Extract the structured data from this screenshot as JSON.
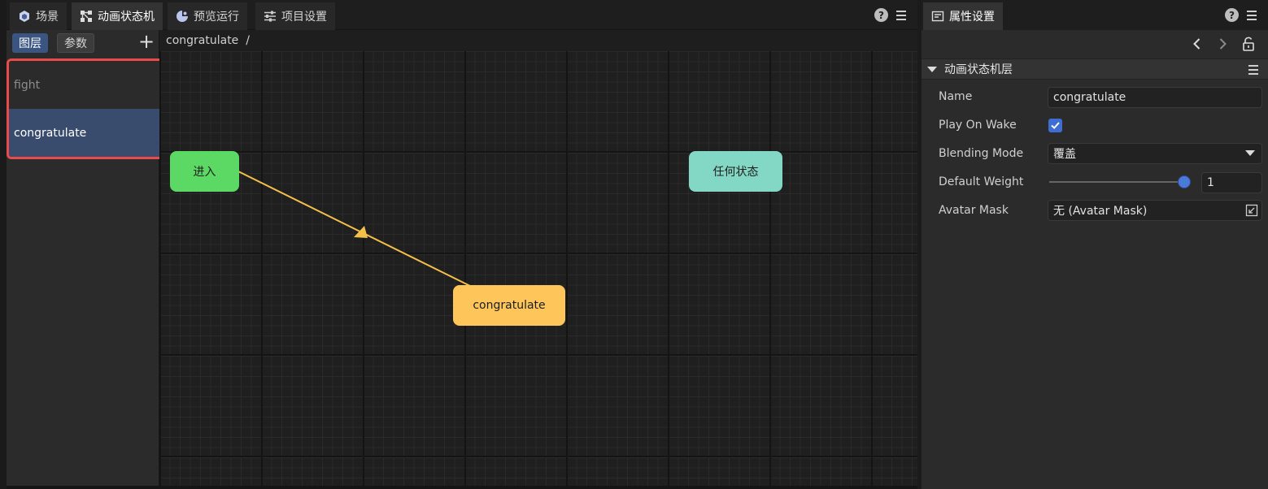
{
  "tabs": [
    {
      "label": "场景",
      "icon": "scene-icon"
    },
    {
      "label": "动画状态机",
      "icon": "animator-icon"
    },
    {
      "label": "预览运行",
      "icon": "preview-icon"
    },
    {
      "label": "项目设置",
      "icon": "settings-icon"
    }
  ],
  "help_glyph": "?",
  "sidebar": {
    "layers_tab": "图层",
    "params_tab": "参数",
    "add": "+",
    "layers": [
      "fight",
      "congratulate"
    ]
  },
  "breadcrumb": "congratulate  /",
  "graph": {
    "entry": "进入",
    "any_state": "任何状态",
    "state": "congratulate"
  },
  "inspector": {
    "tab": "属性设置",
    "section": "动画状态机层",
    "name_label": "Name",
    "name_value": "congratulate",
    "play_label": "Play On Wake",
    "play_checked": true,
    "blend_label": "Blending Mode",
    "blend_value": "覆盖",
    "weight_label": "Default Weight",
    "weight_value": "1",
    "mask_label": "Avatar Mask",
    "mask_value": "无 (Avatar Mask)"
  },
  "colors": {
    "entry": "#5bd964",
    "any_state": "#82d8c5",
    "state": "#fec65a",
    "transition": "#f5c04a",
    "selection": "#e94a4a",
    "accent": "#3e6ed3"
  }
}
